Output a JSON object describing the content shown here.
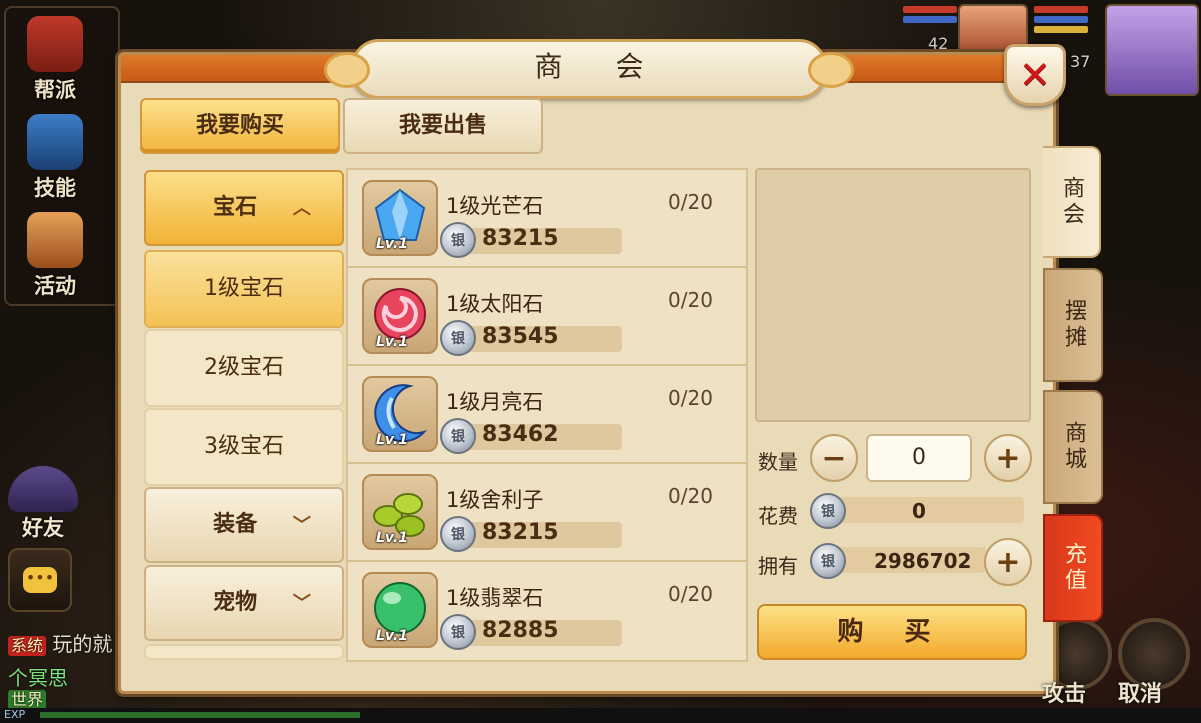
{
  "panel": {
    "title": "商 会"
  },
  "tabs": {
    "buy": "我要购买",
    "sell": "我要出售"
  },
  "categories": {
    "gems": {
      "label": "宝石",
      "expanded": true
    },
    "sub": [
      "1级宝石",
      "2级宝石",
      "3级宝石"
    ],
    "equipment": {
      "label": "装备"
    },
    "pets": {
      "label": "宠物"
    }
  },
  "items": [
    {
      "name": "1级光芒石",
      "count": "0/20",
      "price": "83215",
      "level": "Lv.1",
      "color": "#4aa8f0"
    },
    {
      "name": "1级太阳石",
      "count": "0/20",
      "price": "83545",
      "level": "Lv.1",
      "color": "#e8445e"
    },
    {
      "name": "1级月亮石",
      "count": "0/20",
      "price": "83462",
      "level": "Lv.1",
      "color": "#3f8ee8"
    },
    {
      "name": "1级舍利子",
      "count": "0/20",
      "price": "83215",
      "level": "Lv.1",
      "color": "#a7cc2a"
    },
    {
      "name": "1级翡翠石",
      "count": "0/20",
      "price": "82885",
      "level": "Lv.1",
      "color": "#39c06a"
    }
  ],
  "detail": {
    "quantity_label": "数量",
    "quantity_value": "0",
    "cost_label": "花费",
    "cost_value": "0",
    "owned_label": "拥有",
    "owned_value": "2986702",
    "buy_label": "购 买"
  },
  "side_tabs": [
    "商会",
    "摆摊",
    "商城",
    "充值"
  ],
  "hud": {
    "left_menu": [
      "帮派",
      "技能",
      "活动"
    ],
    "friend": "好友",
    "chat_system_tag": "系统",
    "chat_system_text": "玩的就",
    "chat_name": "个冥思",
    "chat_world_tag": "世界",
    "exp_label": "EXP",
    "attack": "攻击",
    "cancel": "取消",
    "portrait1_level": "42",
    "portrait2_level": "37"
  }
}
